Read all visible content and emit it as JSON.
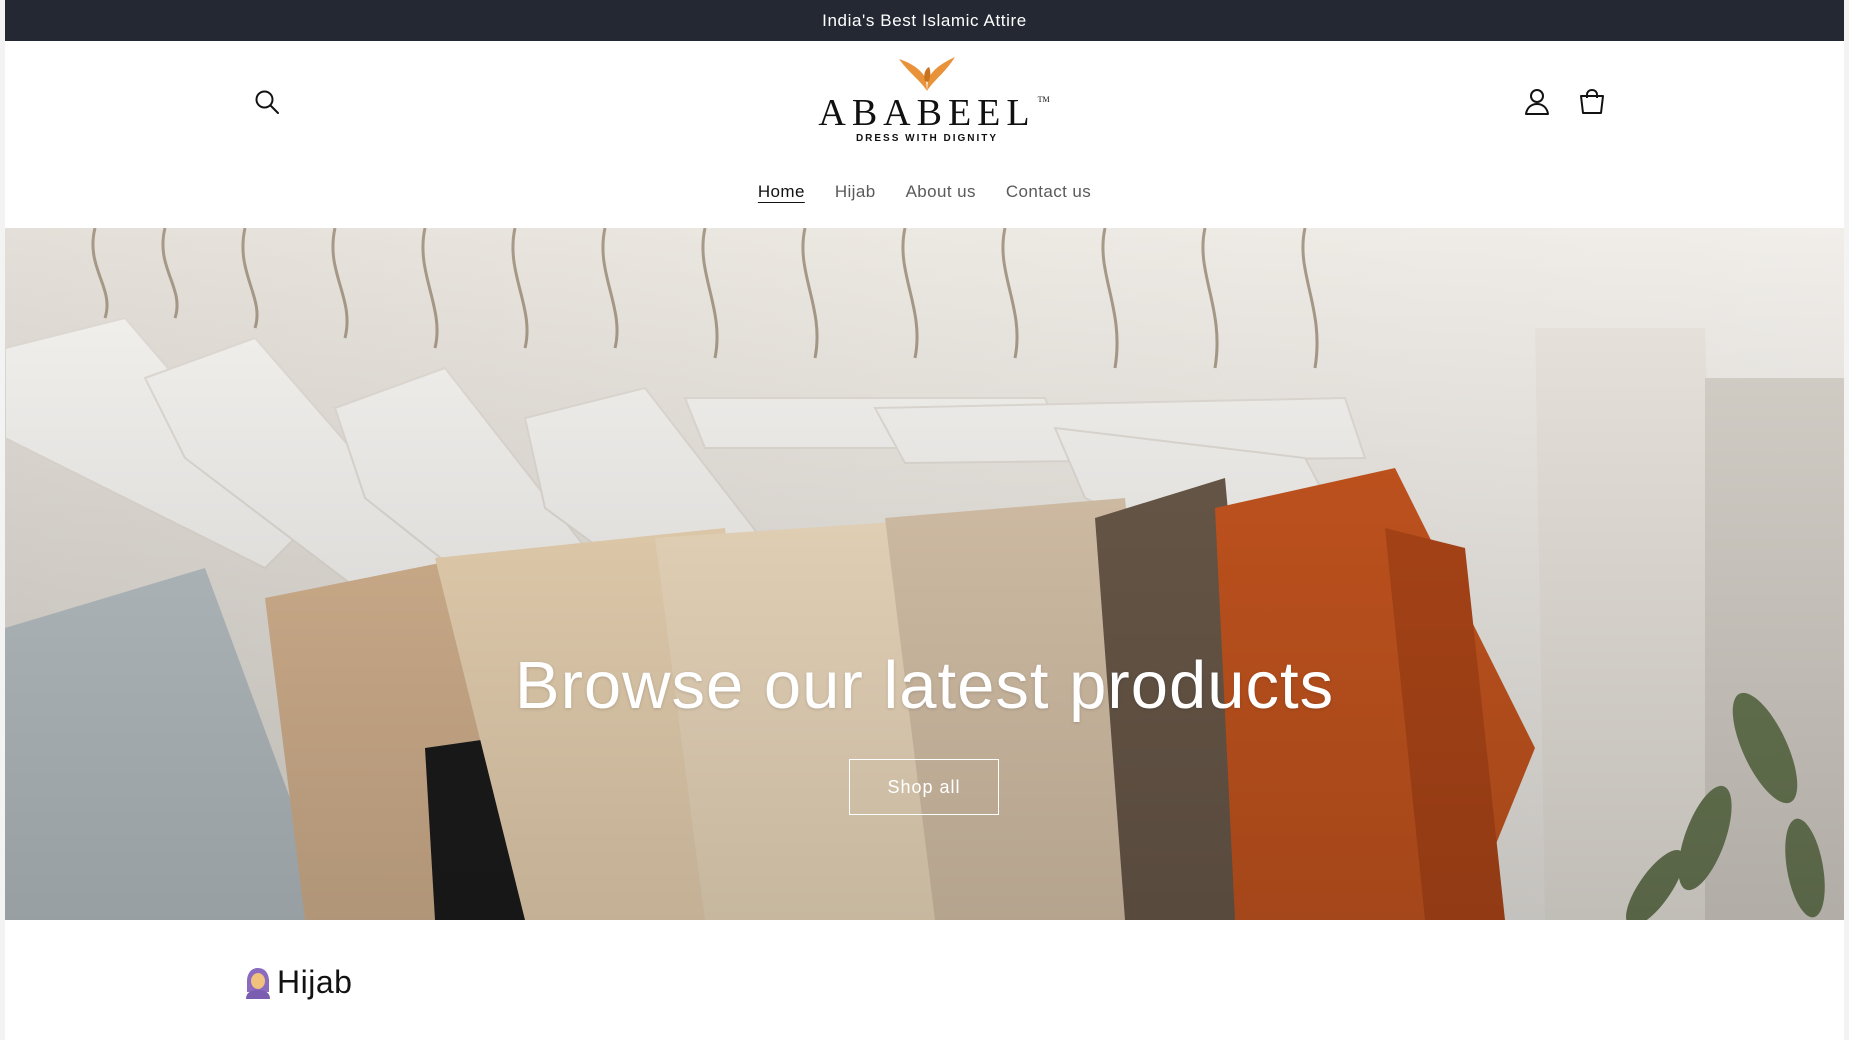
{
  "announcement": {
    "text": "India's Best Islamic Attire"
  },
  "header": {
    "logo": {
      "wordmark": "ABABEEL",
      "trademark": "TM",
      "tagline": "DRESS WITH DIGNITY",
      "bird_color": "#e8923a"
    },
    "icons": {
      "search": "search-icon",
      "account": "account-icon",
      "cart": "cart-icon"
    }
  },
  "nav": {
    "items": [
      {
        "label": "Home",
        "active": true
      },
      {
        "label": "Hijab",
        "active": false
      },
      {
        "label": "About us",
        "active": false
      },
      {
        "label": "Contact us",
        "active": false
      }
    ]
  },
  "hero": {
    "title": "Browse our latest products",
    "button_label": "Shop all"
  },
  "collection": {
    "emoji": "woman-with-headscarf-emoji",
    "title": "Hijab"
  },
  "colors": {
    "announcement_bg": "#232833",
    "accent": "#e8923a",
    "text": "#121212"
  }
}
